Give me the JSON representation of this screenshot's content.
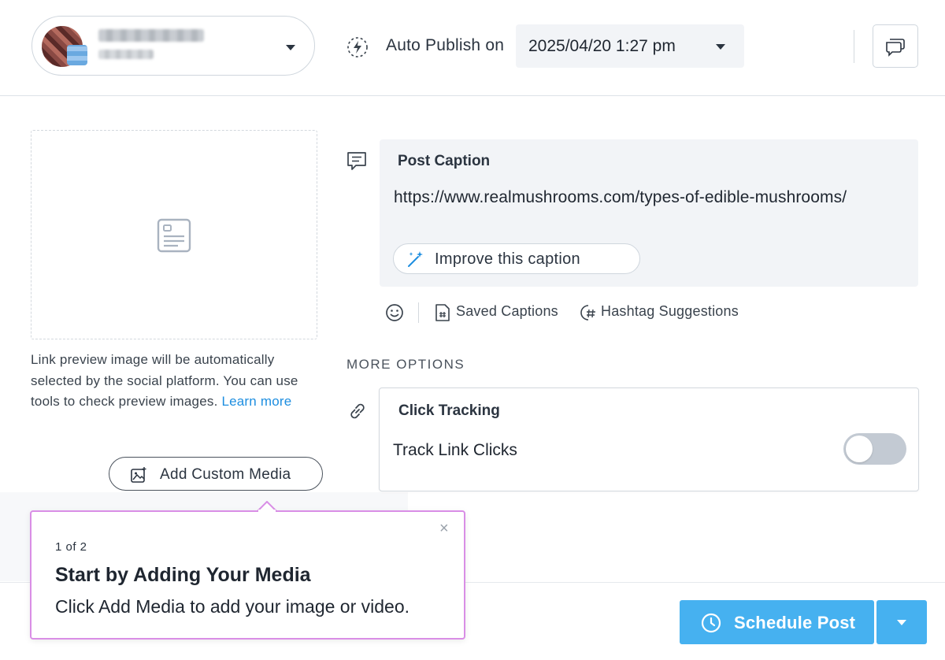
{
  "header": {
    "auto_publish_label": "Auto Publish on",
    "schedule_datetime": "2025/04/20 1:27 pm",
    "icons": {
      "account_caret": "chevron-down-icon",
      "auto_publish": "auto-publish-icon",
      "comments": "comments-icon"
    }
  },
  "media": {
    "link_note": "Link preview image will be automatically selected by the social platform. You can use tools to check preview images.",
    "learn_more": "Learn more",
    "add_custom_media": "Add Custom Media"
  },
  "caption": {
    "title": "Post Caption",
    "text": "https://www.realmushrooms.com/types-of-edible-mushrooms/",
    "improve_button": "Improve this caption",
    "saved_captions": "Saved Captions",
    "hashtag_suggestions": "Hashtag Suggestions"
  },
  "more_options": {
    "heading": "MORE OPTIONS",
    "click_tracking_title": "Click Tracking",
    "track_link_clicks_label": "Track Link Clicks",
    "track_link_clicks_on": false
  },
  "footer": {
    "schedule_button": "Schedule Post"
  },
  "tooltip": {
    "step": "1 of 2",
    "title": "Start by Adding Your Media",
    "body": "Click Add Media to add your image or video.",
    "close": "×"
  },
  "colors": {
    "accent_blue": "#46b1f0",
    "link_blue": "#1d8ee0",
    "tooltip_border": "#d98ee6",
    "panel_bg": "#f2f4f7"
  }
}
